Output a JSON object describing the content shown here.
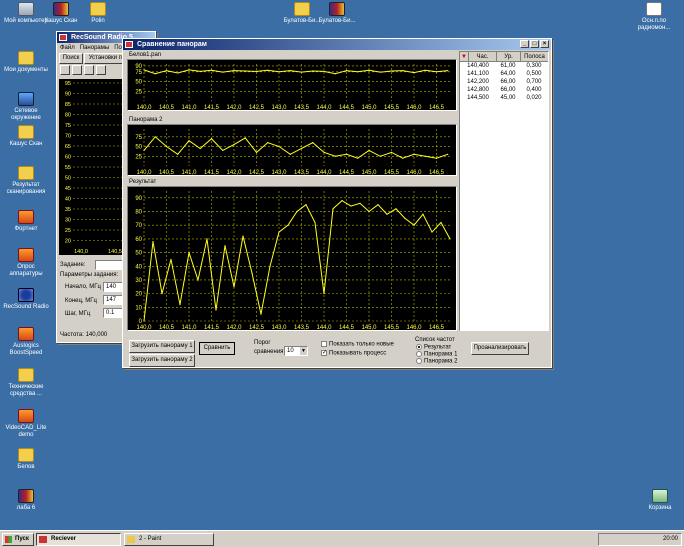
{
  "desktop": {
    "icons": [
      {
        "label": "Мой компьютер",
        "icon": "computer-icon"
      },
      {
        "label": "Мои документы",
        "icon": "folder-icon"
      },
      {
        "label": "Сетевое окружение",
        "icon": "network-icon"
      },
      {
        "label": "Кашус Скан",
        "icon": "folder-icon"
      },
      {
        "label": "Результат сканирования",
        "icon": "folder-icon"
      },
      {
        "label": "Фортнет",
        "icon": "app-icon"
      },
      {
        "label": "Опрос аппаратуры",
        "icon": "app-icon"
      },
      {
        "label": "RecSound Radio",
        "icon": "radio-icon"
      },
      {
        "label": "Auslogics BoostSpeed",
        "icon": "app-icon"
      },
      {
        "label": "Технические средства ...",
        "icon": "folder-icon"
      },
      {
        "label": "VideoCAD_Lite demo",
        "icon": "app-icon"
      },
      {
        "label": "Белов",
        "icon": "folder-icon"
      },
      {
        "label": "лаба 6",
        "icon": "archive-icon"
      },
      {
        "label": "Кашус Скан",
        "icon": "archive-icon"
      },
      {
        "label": "Polin",
        "icon": "folder-icon"
      },
      {
        "label": "Булатов-Би...",
        "icon": "folder-icon"
      },
      {
        "label": "Булатов-Би...",
        "icon": "archive-icon"
      },
      {
        "label": "Осн.п.по радиомон...",
        "icon": "document-icon"
      },
      {
        "label": "Корзина",
        "icon": "recycle-bin-icon"
      }
    ]
  },
  "back_window": {
    "title": "RecSound Radio 5...",
    "menu": [
      "Файл",
      "Панорамы",
      "По"
    ],
    "tabs": [
      "Поиск",
      "Установки по"
    ],
    "task_label": "Задание:",
    "params_label": "Параметры задания:",
    "start_label": "Начало, МГц",
    "start_value": "140",
    "end_label": "Конец, МГц",
    "end_value": "147",
    "step_label": "Шаг, МГц",
    "step_value": "0.1",
    "status": "Частота: 140,000",
    "y_ticks": [
      "95",
      "90",
      "85",
      "80",
      "75",
      "70",
      "65",
      "60",
      "55",
      "50",
      "45",
      "40",
      "35",
      "30",
      "25",
      "20"
    ],
    "x_ticks": [
      "140,0",
      "140,5"
    ]
  },
  "main_window": {
    "title": "Сравнение панорам",
    "panel1_title": "Белов1.pan",
    "panel2_title": "Панорама 2",
    "panel3_title": "Результат",
    "x_ticks": [
      "140,0",
      "140,5",
      "141,0",
      "141,5",
      "142,0",
      "142,5",
      "143,0",
      "143,5",
      "144,0",
      "144,5",
      "145,0",
      "145,5",
      "146,0",
      "146,5"
    ],
    "small_y_ticks": [
      "75",
      "50",
      "25"
    ],
    "small_y_ticks_top": [
      "90",
      "75",
      "50",
      "25"
    ],
    "big_y_ticks": [
      "90",
      "80",
      "70",
      "60",
      "50",
      "40",
      "30",
      "20",
      "10",
      "0"
    ],
    "btn_load1": "Загрузить панораму 1",
    "btn_load2": "Загрузить панораму 2",
    "btn_compare": "Сравнить",
    "threshold_label": "Порог",
    "compare_label": "сравнения",
    "threshold_value": "10",
    "chk_new": "Показать только новые",
    "chk_process": "Показывать процесс",
    "freq_list_label": "Список частот",
    "radio_result": "Результат",
    "radio_p1": "Панорама 1",
    "radio_p2": "Панорама 2",
    "btn_analyze": "Проанализировать",
    "table": {
      "headers": [
        "Час.",
        "Ур.",
        "Полоса"
      ],
      "rows": [
        [
          "140,400",
          "61,00",
          "0,300"
        ],
        [
          "141,100",
          "64,00",
          "0,500"
        ],
        [
          "142,200",
          "66,00",
          "0,700"
        ],
        [
          "142,800",
          "66,00",
          "0,400"
        ],
        [
          "144,500",
          "45,00",
          "0,020"
        ]
      ]
    }
  },
  "taskbar": {
    "start": "Пуск",
    "task1": "Reciever",
    "task2": "2 - Paint",
    "time": "20:00"
  },
  "chart_data": [
    {
      "type": "line",
      "title": "Белов1.pan",
      "x": [
        140.0,
        140.25,
        140.5,
        140.75,
        141.0,
        141.25,
        141.5,
        141.75,
        142.0,
        142.25,
        142.5,
        142.75,
        143.0,
        143.25,
        143.5,
        143.75,
        144.0,
        144.25,
        144.5,
        144.75,
        145.0,
        145.25,
        145.5,
        145.75,
        146.0,
        146.25,
        146.5,
        146.75
      ],
      "y": [
        80,
        70,
        78,
        72,
        80,
        76,
        79,
        74,
        78,
        77,
        76,
        79,
        75,
        78,
        74,
        77,
        76,
        70,
        78,
        75,
        79,
        74,
        77,
        78,
        73,
        79,
        75,
        78
      ],
      "ylim": [
        0,
        95
      ]
    },
    {
      "type": "line",
      "title": "Панорама 2",
      "x": [
        140.0,
        140.25,
        140.5,
        140.75,
        141.0,
        141.25,
        141.5,
        141.75,
        142.0,
        142.25,
        142.5,
        142.75,
        143.0,
        143.25,
        143.5,
        143.75,
        144.0,
        144.25,
        144.5,
        144.75,
        145.0,
        145.25,
        145.5,
        145.75,
        146.0,
        146.25,
        146.5,
        146.75
      ],
      "y": [
        40,
        75,
        50,
        30,
        65,
        45,
        70,
        40,
        55,
        72,
        35,
        60,
        50,
        30,
        45,
        60,
        35,
        25,
        30,
        20,
        40,
        25,
        35,
        20,
        30,
        25,
        20,
        30
      ],
      "ylim": [
        0,
        95
      ]
    },
    {
      "type": "line",
      "title": "Результат",
      "x": [
        140.0,
        140.2,
        140.4,
        140.6,
        140.8,
        141.0,
        141.2,
        141.4,
        141.6,
        141.8,
        142.0,
        142.2,
        142.4,
        142.6,
        142.8,
        143.0,
        143.2,
        143.4,
        143.6,
        143.8,
        144.0,
        144.2,
        144.4,
        144.6,
        144.8,
        145.0,
        145.2,
        145.4,
        145.6,
        145.8,
        146.0,
        146.2,
        146.4,
        146.6,
        146.8
      ],
      "y": [
        0,
        58,
        20,
        45,
        12,
        50,
        30,
        60,
        8,
        55,
        25,
        62,
        35,
        5,
        40,
        65,
        70,
        80,
        85,
        72,
        20,
        82,
        88,
        84,
        86,
        80,
        85,
        78,
        82,
        75,
        70,
        78,
        65,
        72,
        60
      ],
      "ylim": [
        0,
        95
      ]
    }
  ]
}
